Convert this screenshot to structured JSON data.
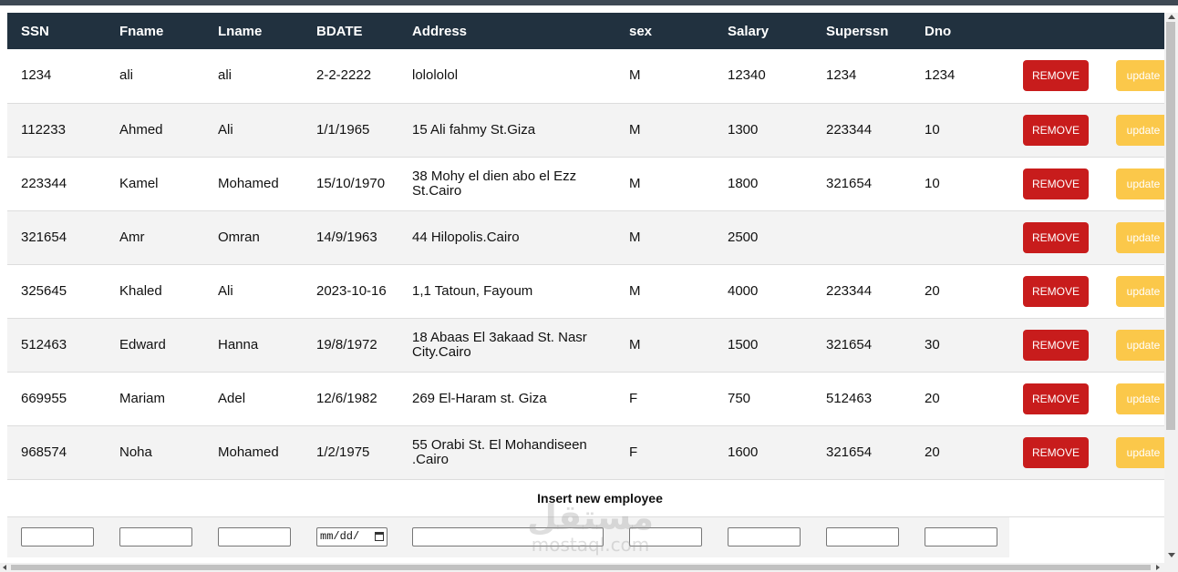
{
  "table": {
    "headers": [
      "SSN",
      "Fname",
      "Lname",
      "BDATE",
      "Address",
      "sex",
      "Salary",
      "Superssn",
      "Dno"
    ],
    "rows": [
      {
        "ssn": "1234",
        "fname": "ali",
        "lname": "ali",
        "bdate": "2-2-2222",
        "address": "lolololol",
        "sex": "M",
        "salary": "12340",
        "superssn": "1234",
        "dno": "1234"
      },
      {
        "ssn": "112233",
        "fname": "Ahmed",
        "lname": "Ali",
        "bdate": "1/1/1965",
        "address": "15 Ali fahmy St.Giza",
        "sex": "M",
        "salary": "1300",
        "superssn": "223344",
        "dno": "10"
      },
      {
        "ssn": "223344",
        "fname": "Kamel",
        "lname": "Mohamed",
        "bdate": "15/10/1970",
        "address": "38 Mohy el dien abo el Ezz St.Cairo",
        "sex": "M",
        "salary": "1800",
        "superssn": "321654",
        "dno": "10"
      },
      {
        "ssn": "321654",
        "fname": "Amr",
        "lname": "Omran",
        "bdate": "14/9/1963",
        "address": "44 Hilopolis.Cairo",
        "sex": "M",
        "salary": "2500",
        "superssn": "",
        "dno": ""
      },
      {
        "ssn": "325645",
        "fname": "Khaled",
        "lname": "Ali",
        "bdate": "2023-10-16",
        "address": "1,1 Tatoun, Fayoum",
        "sex": "M",
        "salary": "4000",
        "superssn": "223344",
        "dno": "20"
      },
      {
        "ssn": "512463",
        "fname": "Edward",
        "lname": "Hanna",
        "bdate": "19/8/1972",
        "address": "18 Abaas El 3akaad St. Nasr City.Cairo",
        "sex": "M",
        "salary": "1500",
        "superssn": "321654",
        "dno": "30"
      },
      {
        "ssn": "669955",
        "fname": "Mariam",
        "lname": "Adel",
        "bdate": "12/6/1982",
        "address": "269 El-Haram st. Giza",
        "sex": "F",
        "salary": "750",
        "superssn": "512463",
        "dno": "20"
      },
      {
        "ssn": "968574",
        "fname": "Noha",
        "lname": "Mohamed",
        "bdate": "1/2/1975",
        "address": "55 Orabi St. El Mohandiseen .Cairo",
        "sex": "F",
        "salary": "1600",
        "superssn": "321654",
        "dno": "20"
      }
    ],
    "remove_label": "REMOVE",
    "update_label": "update"
  },
  "insert": {
    "title": "Insert new employee",
    "date_placeholder": "mm/dd/"
  },
  "watermark": {
    "arabic": "مستقل",
    "latin": "mostaql.com"
  },
  "colors": {
    "header_bg": "#21313f",
    "remove": "#c81c1c",
    "update": "#fbc84a",
    "accent_line": "#009879"
  },
  "icons": {
    "date_picker": "calendar-icon"
  }
}
